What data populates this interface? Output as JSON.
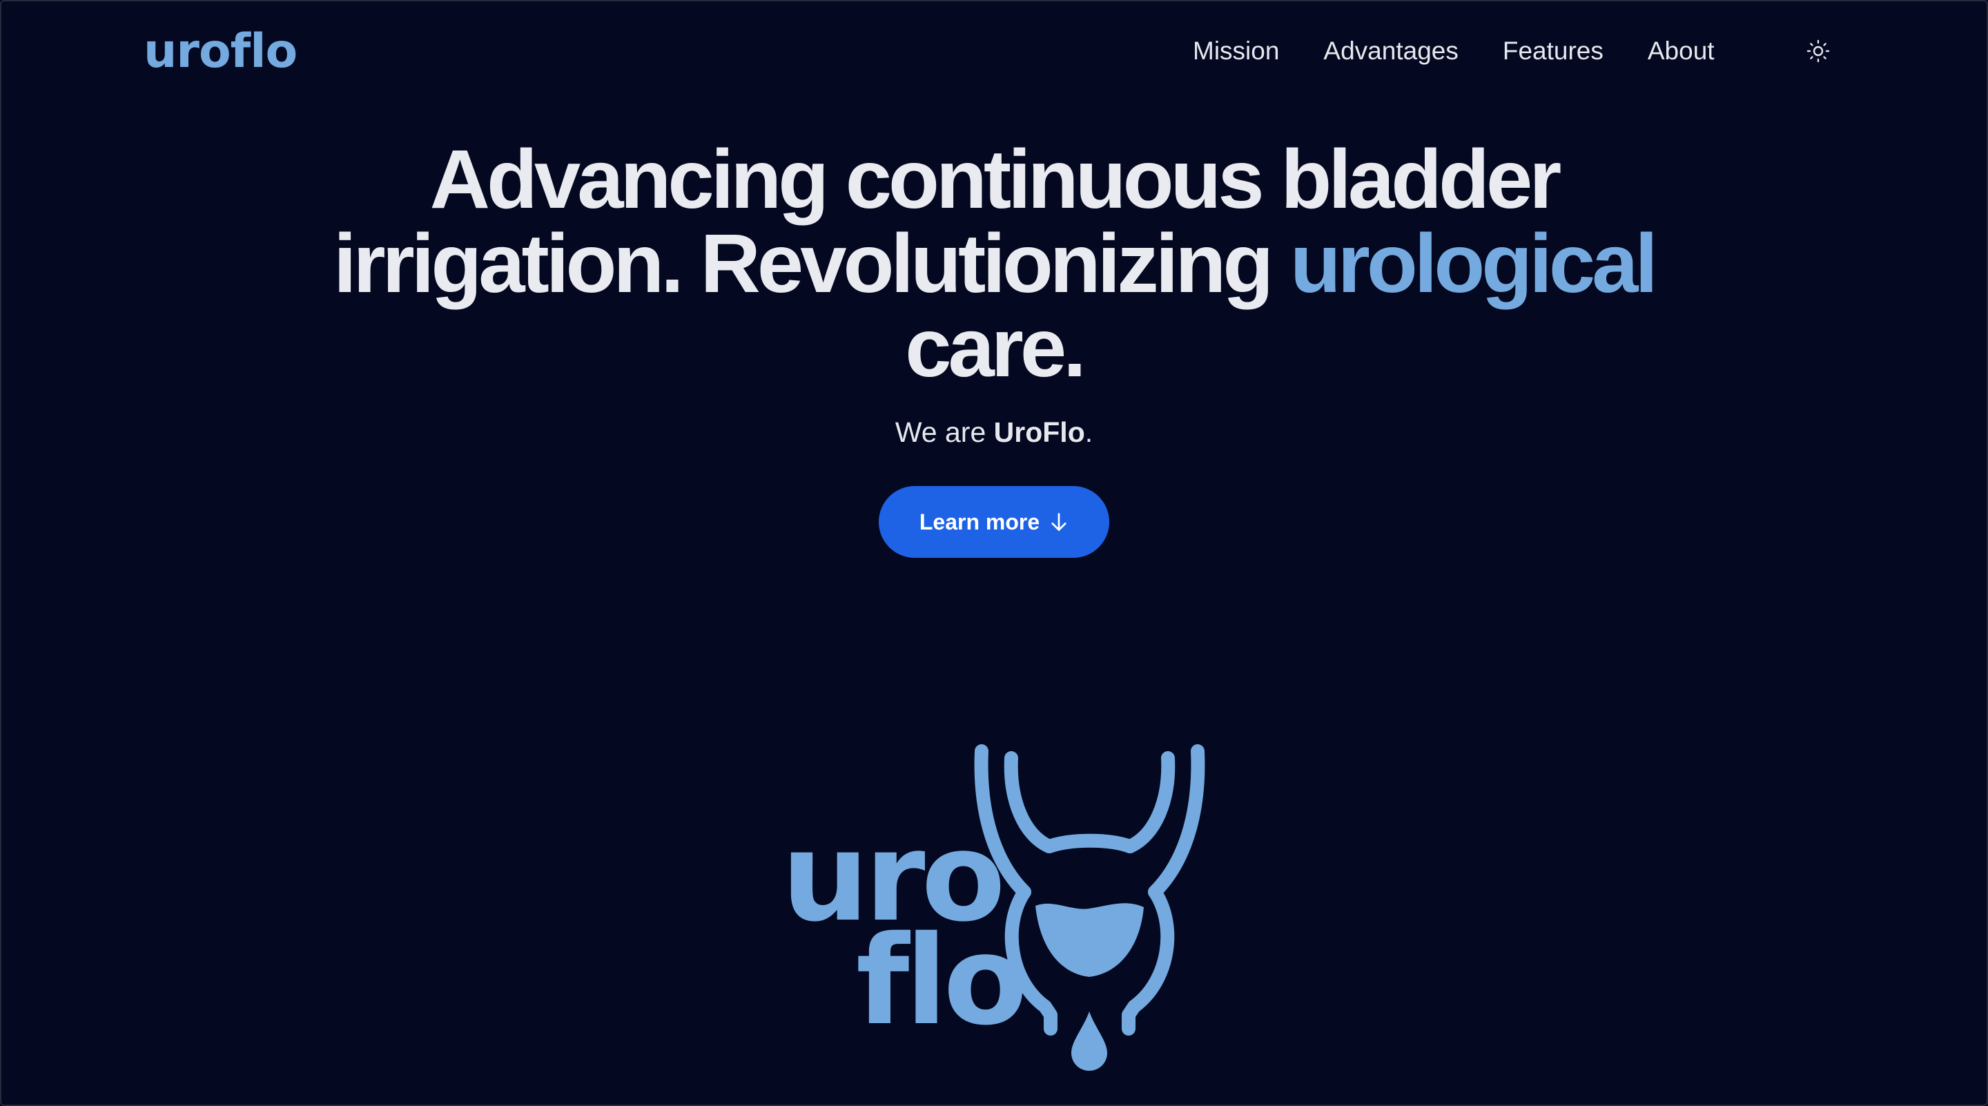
{
  "header": {
    "brand": "uroflo",
    "nav": [
      {
        "label": "Mission"
      },
      {
        "label": "Advantages"
      },
      {
        "label": "Features"
      },
      {
        "label": "About"
      }
    ],
    "theme_toggle_icon": "sun-icon"
  },
  "hero": {
    "headline_line1": "Advancing continuous bladder",
    "headline_line2_prefix": "irrigation. Revolutionizing ",
    "headline_line2_accent": "urological",
    "headline_line3": "care.",
    "sub_prefix": "We are ",
    "sub_brand": "UroFlo",
    "sub_suffix": ".",
    "cta_label": "Learn more",
    "cta_icon": "arrow-down-icon"
  },
  "logo": {
    "word_top": "uro",
    "word_bottom": "flo",
    "mark_icon": "bladder-drop-icon"
  },
  "colors": {
    "background": "#040820",
    "accent": "#74aadf",
    "button": "#1e63e6",
    "text": "#eaebf0"
  }
}
